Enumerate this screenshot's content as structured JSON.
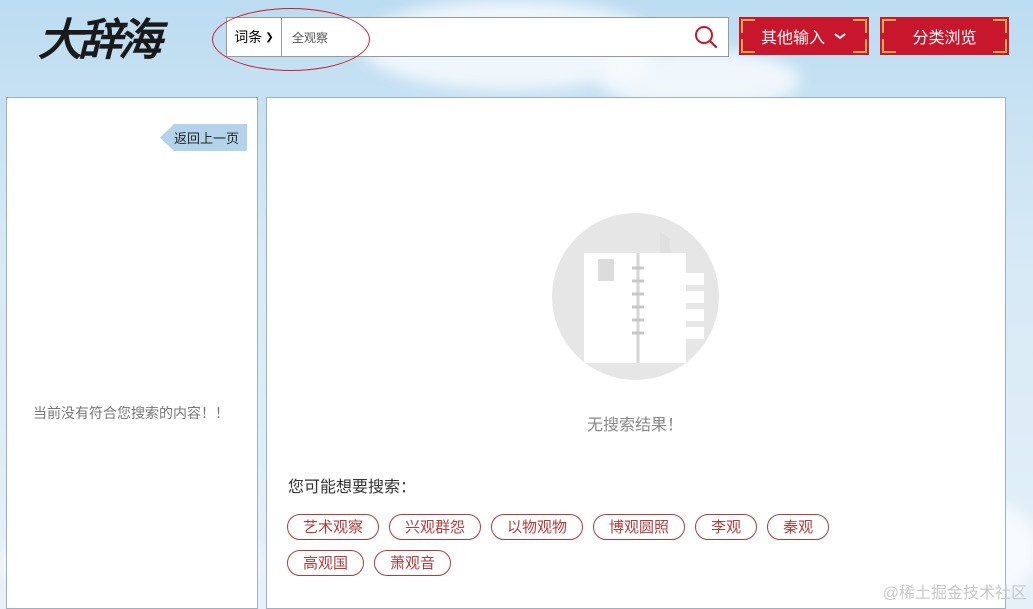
{
  "header": {
    "logo_text": "大辞海",
    "search": {
      "scope_value": "词条",
      "input_value": "全观察",
      "placeholder": ""
    },
    "other_input_label": "其他输入",
    "browse_label": "分类浏览"
  },
  "left_panel": {
    "back_label": "返回上一页",
    "empty_message": "当前没有符合您搜索的内容！！"
  },
  "main": {
    "no_result": "无搜索结果！",
    "suggest_title": "您可能想要搜索：",
    "suggestions": [
      "艺术观察",
      "兴观群怨",
      "以物观物",
      "博观圆照",
      "李观",
      "秦观",
      "高观国",
      "萧观音"
    ]
  },
  "watermark": "@稀土掘金技术社区",
  "colors": {
    "brand_red": "#c8162c",
    "tag_red": "#b33b3b",
    "panel_border": "#9ab2c8",
    "back_button": "#b3d3ea"
  },
  "icons": {
    "search": "search-icon",
    "chevron": "chevron-down-icon",
    "back": "arrow-left-tag",
    "empty": "empty-notebook-icon"
  }
}
